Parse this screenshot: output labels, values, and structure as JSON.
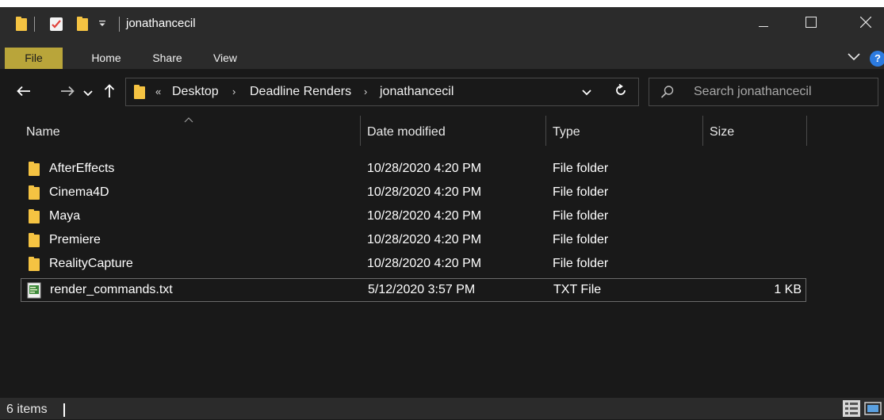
{
  "window": {
    "title": "jonathancecil",
    "controls": {
      "minimize_icon": "minimize-icon",
      "maximize_icon": "maximize-icon",
      "close_icon": "close-icon"
    }
  },
  "ribbon": {
    "tabs": [
      {
        "label": "File",
        "active": true
      },
      {
        "label": "Home"
      },
      {
        "label": "Share"
      },
      {
        "label": "View"
      }
    ],
    "accent": "#b9a53a"
  },
  "nav": {
    "breadcrumb_overflow": "«",
    "breadcrumbs": [
      "Desktop",
      "Deadline Renders",
      "jonathancecil"
    ],
    "search_placeholder": "Search jonathancecil"
  },
  "columns": {
    "name": "Name",
    "date": "Date modified",
    "type": "Type",
    "size": "Size",
    "sorted_by": "Name"
  },
  "rows": [
    {
      "name": "AfterEffects",
      "date": "10/28/2020 4:20 PM",
      "type": "File folder",
      "size": "",
      "icon": "folder-icon"
    },
    {
      "name": "Cinema4D",
      "date": "10/28/2020 4:20 PM",
      "type": "File folder",
      "size": "",
      "icon": "folder-icon"
    },
    {
      "name": "Maya",
      "date": "10/28/2020 4:20 PM",
      "type": "File folder",
      "size": "",
      "icon": "folder-icon"
    },
    {
      "name": "Premiere",
      "date": "10/28/2020 4:20 PM",
      "type": "File folder",
      "size": "",
      "icon": "folder-icon"
    },
    {
      "name": "RealityCapture",
      "date": "10/28/2020 4:20 PM",
      "type": "File folder",
      "size": "",
      "icon": "folder-icon"
    },
    {
      "name": "render_commands.txt",
      "date": "5/12/2020 3:57 PM",
      "type": "TXT File",
      "size": "1 KB",
      "icon": "text-file-icon",
      "selected": true
    }
  ],
  "status": {
    "item_count": "6 items"
  },
  "colors": {
    "background": "#191919",
    "chrome": "#2b2b2b",
    "folder": "#f5c342",
    "help": "#2c7be0"
  }
}
